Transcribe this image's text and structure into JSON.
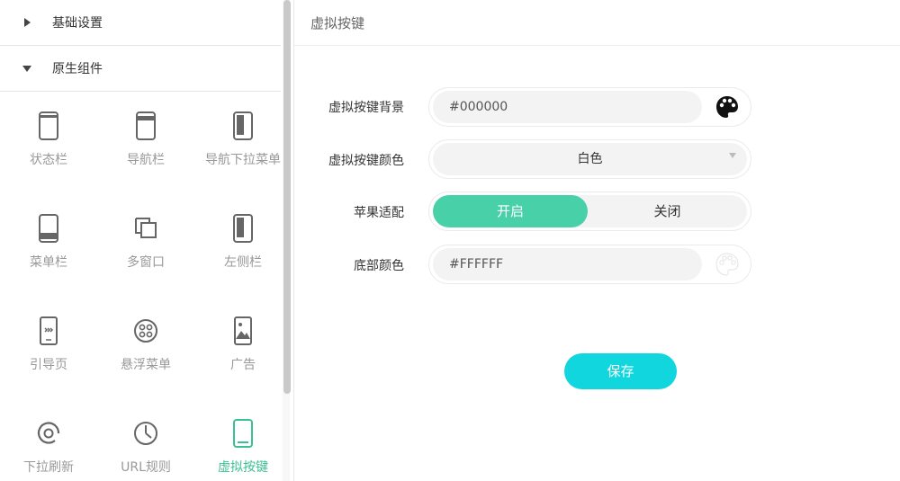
{
  "sidebar": {
    "sections": [
      {
        "label": "基础设置",
        "expanded": false
      },
      {
        "label": "原生组件",
        "expanded": true
      }
    ],
    "items": [
      {
        "label": "状态栏",
        "icon": "phone-statusbar-icon",
        "active": false
      },
      {
        "label": "导航栏",
        "icon": "phone-navbar-icon",
        "active": false
      },
      {
        "label": "导航下拉菜单",
        "icon": "phone-dropdown-icon",
        "active": false
      },
      {
        "label": "菜单栏",
        "icon": "phone-menubar-icon",
        "active": false
      },
      {
        "label": "多窗口",
        "icon": "multi-window-icon",
        "active": false
      },
      {
        "label": "左侧栏",
        "icon": "phone-leftbar-icon",
        "active": false
      },
      {
        "label": "引导页",
        "icon": "guide-page-icon",
        "active": false
      },
      {
        "label": "悬浮菜单",
        "icon": "float-menu-icon",
        "active": false
      },
      {
        "label": "广告",
        "icon": "ad-image-icon",
        "active": false
      },
      {
        "label": "下拉刷新",
        "icon": "refresh-icon",
        "active": false
      },
      {
        "label": "URL规则",
        "icon": "url-rule-clock-icon",
        "active": false
      },
      {
        "label": "虚拟按键",
        "icon": "virtual-key-phone-icon",
        "active": true
      }
    ]
  },
  "main": {
    "title": "虚拟按键",
    "fields": {
      "background": {
        "label": "虚拟按键背景",
        "value": "#000000",
        "icon": "palette-icon"
      },
      "color": {
        "label": "虚拟按键颜色",
        "value": "白色"
      },
      "adapt": {
        "label": "苹果适配",
        "on_label": "开启",
        "off_label": "关闭",
        "selected": "开启"
      },
      "bottom": {
        "label": "底部颜色",
        "value": "#FFFFFF",
        "icon": "palette-icon"
      }
    },
    "save_label": "保存"
  },
  "colors": {
    "accent_green": "#48d1a8",
    "save_cyan": "#12d6de",
    "active_text": "#3bbf95"
  }
}
